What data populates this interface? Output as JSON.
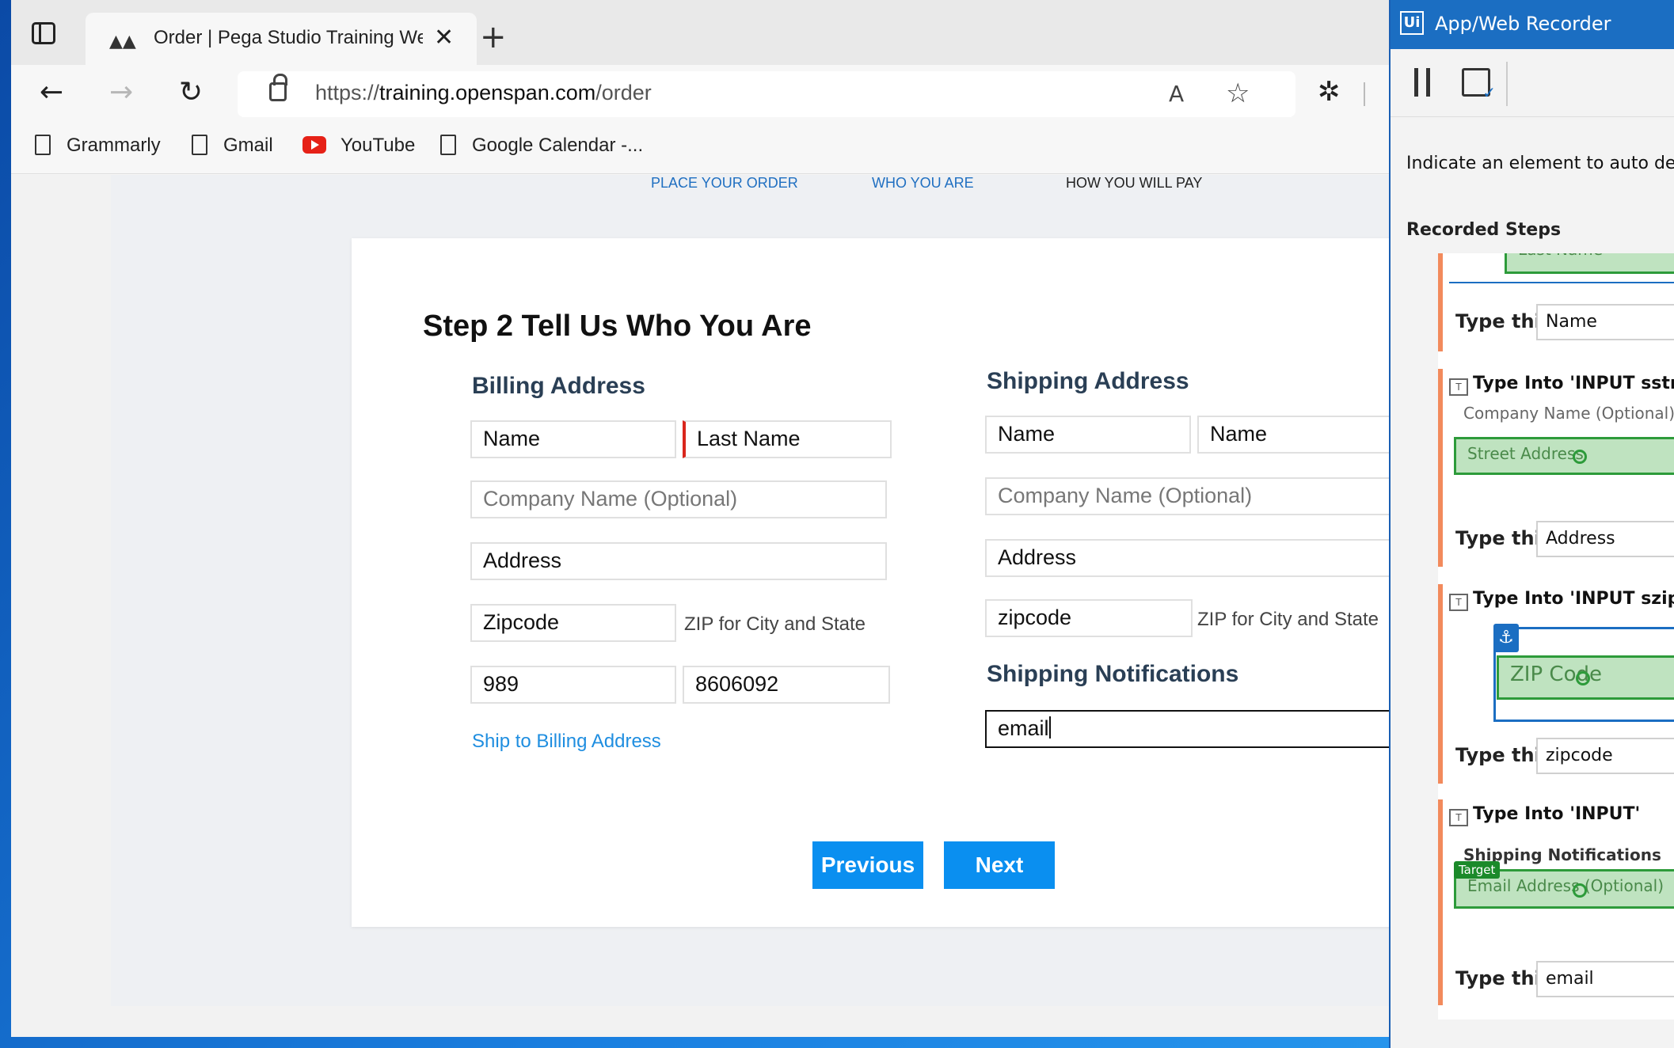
{
  "browser": {
    "tab_title": "Order | Pega Studio Training Web",
    "close_glyph": "✕",
    "newtab_glyph": "+",
    "url_prefix": "https://",
    "url_host": "training.openspan.com",
    "url_path": "/order",
    "read_aloud": "A",
    "bookmarks": [
      "Grammarly",
      "Gmail",
      "YouTube",
      "Google Calendar -..."
    ]
  },
  "wizard_steps": [
    "PLACE YOUR ORDER",
    "WHO YOU ARE",
    "HOW YOU WILL PAY"
  ],
  "form": {
    "title": "Step 2 Tell Us Who You Are",
    "billing": {
      "heading": "Billing Address",
      "first_name": "Name",
      "last_name": "Last Name",
      "company_placeholder": "Company Name (Optional)",
      "address": "Address",
      "zipcode": "Zipcode",
      "zip_hint": "ZIP for City and State",
      "phone_area": "989",
      "phone_number": "8606092",
      "ship_link": "Ship to Billing Address"
    },
    "shipping": {
      "heading": "Shipping Address",
      "first_name": "Name",
      "last_name": "Name",
      "company_placeholder": "Company Name (Optional)",
      "address": "Address",
      "zipcode": "zipcode",
      "zip_hint": "ZIP for City and State",
      "notifications_heading": "Shipping Notifications",
      "email": "email"
    },
    "previous_label": "Previous",
    "next_label": "Next"
  },
  "recorder": {
    "logo": "Ui",
    "title": "App/Web Recorder",
    "hint": "Indicate an element to auto dete",
    "section": "Recorded Steps",
    "steps": [
      {
        "header": "",
        "preview_label": "Last Name",
        "type_label": "Type this",
        "type_value": "Name"
      },
      {
        "header": "Type Into 'INPUT sstree",
        "preview_gray": "Company Name (Optional)",
        "preview_label": "Street Address",
        "type_label": "Type this",
        "type_value": "Address"
      },
      {
        "header": "Type Into 'INPUT szip_",
        "preview_label": "ZIP Code",
        "type_label": "Type this",
        "type_value": "zipcode"
      },
      {
        "header": "Type Into 'INPUT'",
        "preview_gray": "Shipping Notifications",
        "target_badge": "Target",
        "preview_label": "Email Address (Optional)",
        "type_label": "Type this",
        "type_value": "email"
      }
    ]
  },
  "colors": {
    "accent": "#0a8ff0",
    "link": "#1f8ee0",
    "recorder_title": "#1b6ec2",
    "step_border": "#f28a5c",
    "target_green": "#2d9b3a"
  }
}
